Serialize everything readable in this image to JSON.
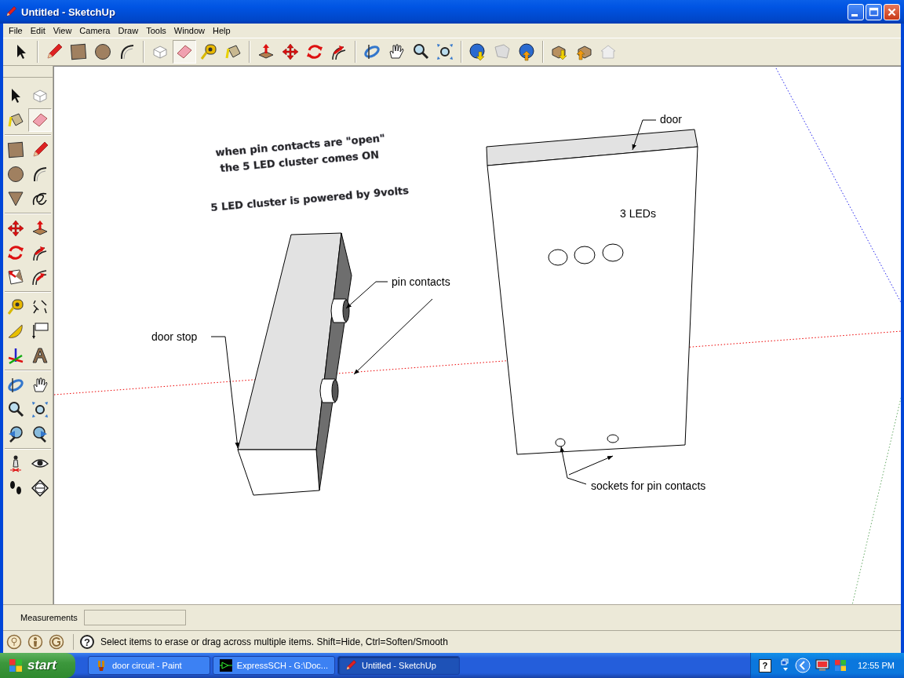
{
  "window": {
    "title": "Untitled - SketchUp",
    "buttons": [
      {
        "kind": "minimize"
      },
      {
        "kind": "maximize"
      },
      {
        "kind": "close"
      }
    ]
  },
  "menu": [
    "File",
    "Edit",
    "View",
    "Camera",
    "Draw",
    "Tools",
    "Window",
    "Help"
  ],
  "main_toolbar": {
    "groups": [
      [
        {
          "kind": "select",
          "selected": false
        }
      ],
      [
        {
          "kind": "pencil",
          "selected": false
        },
        {
          "kind": "rectangle",
          "selected": false
        },
        {
          "kind": "circle",
          "selected": false
        },
        {
          "kind": "arc",
          "selected": false
        }
      ],
      [
        {
          "kind": "component",
          "selected": false
        },
        {
          "kind": "eraser",
          "selected": true
        },
        {
          "kind": "tape",
          "selected": false
        },
        {
          "kind": "paint",
          "selected": false
        }
      ],
      [
        {
          "kind": "pushpull",
          "selected": false
        },
        {
          "kind": "move",
          "selected": false
        },
        {
          "kind": "rotate",
          "selected": false
        },
        {
          "kind": "followme",
          "selected": false
        }
      ],
      [
        {
          "kind": "orbit",
          "selected": false
        },
        {
          "kind": "pan",
          "selected": false
        },
        {
          "kind": "zoom",
          "selected": false
        },
        {
          "kind": "zoomext",
          "selected": false
        }
      ],
      [
        {
          "kind": "globedown",
          "selected": false
        },
        {
          "kind": "page",
          "selected": false
        },
        {
          "kind": "globeup",
          "selected": false
        }
      ],
      [
        {
          "kind": "boxdown",
          "selected": false
        },
        {
          "kind": "boxup",
          "selected": false
        },
        {
          "kind": "house",
          "selected": false
        }
      ]
    ]
  },
  "tool_palette": {
    "groups": [
      [
        {
          "kind": "select",
          "selected": false
        },
        {
          "kind": "component",
          "selected": false
        },
        {
          "kind": "paint",
          "selected": false
        },
        {
          "kind": "eraser",
          "selected": true
        }
      ],
      [
        {
          "kind": "rectangle",
          "selected": false
        },
        {
          "kind": "pencil",
          "selected": false
        },
        {
          "kind": "circle",
          "selected": false
        },
        {
          "kind": "arc",
          "selected": false
        },
        {
          "kind": "polygon",
          "selected": false
        },
        {
          "kind": "freehand",
          "selected": false
        }
      ],
      [
        {
          "kind": "move",
          "selected": false
        },
        {
          "kind": "pushpull",
          "selected": false
        },
        {
          "kind": "rotate",
          "selected": false
        },
        {
          "kind": "followme",
          "selected": false
        },
        {
          "kind": "scale",
          "selected": false
        },
        {
          "kind": "offset",
          "selected": false
        }
      ],
      [
        {
          "kind": "tape",
          "selected": false
        },
        {
          "kind": "dimension",
          "selected": false
        },
        {
          "kind": "protractor",
          "selected": false
        },
        {
          "kind": "text",
          "selected": false
        },
        {
          "kind": "axes",
          "selected": false
        },
        {
          "kind": "text3d",
          "selected": false
        }
      ],
      [
        {
          "kind": "orbit",
          "selected": false
        },
        {
          "kind": "pan",
          "selected": false
        },
        {
          "kind": "zoom",
          "selected": false
        },
        {
          "kind": "zoomext",
          "selected": false
        },
        {
          "kind": "previous",
          "selected": false
        },
        {
          "kind": "next",
          "selected": false
        }
      ],
      [
        {
          "kind": "walk",
          "selected": false
        },
        {
          "kind": "look",
          "selected": false
        },
        {
          "kind": "footprints",
          "selected": false
        },
        {
          "kind": "section",
          "selected": false
        }
      ]
    ]
  },
  "canvas": {
    "notes": [
      "when pin contacts are \"open\"",
      "the 5 LED cluster comes ON",
      "5 LED cluster is powered by 9volts"
    ],
    "labels": [
      "door",
      "3 LEDs",
      "pin contacts",
      "door stop",
      "sockets for pin contacts"
    ]
  },
  "measurements": {
    "label": "Measurements"
  },
  "status_bar": {
    "help_icon": "?",
    "text": "Select items to erase or drag across multiple items. Shift=Hide, Ctrl=Soften/Smooth"
  },
  "taskbar": {
    "start": "start",
    "tasks": [
      {
        "kind": "paint",
        "label": "door circuit - Paint",
        "selected": false
      },
      {
        "kind": "schematic",
        "label": "ExpressSCH - G:\\Doc...",
        "selected": false
      },
      {
        "kind": "sketchup",
        "label": "Untitled - SketchUp",
        "selected": true
      }
    ],
    "tray_help": "?",
    "clock": "12:55 PM"
  }
}
